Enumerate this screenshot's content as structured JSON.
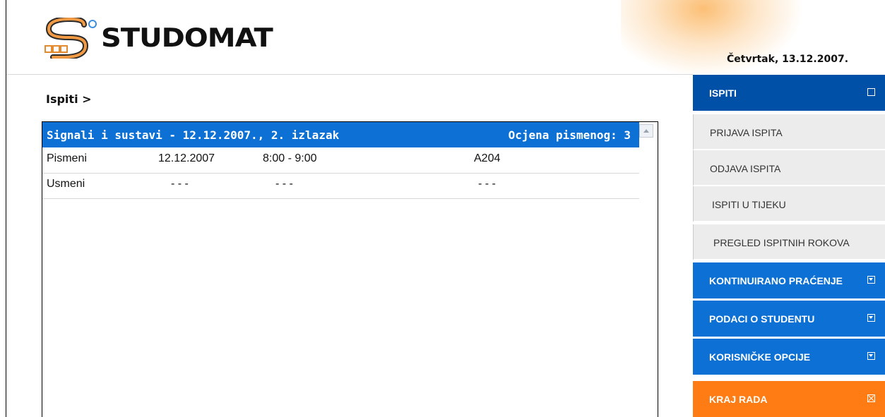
{
  "header": {
    "logo_text": "STUDOMAT",
    "date": "Četvrtak, 13.12.2007."
  },
  "breadcrumb": "Ispiti >",
  "exam": {
    "title": "Signali i sustavi - 12.12.2007., 2. izlazak",
    "grade": "Ocjena pismenog: 3",
    "rows": [
      {
        "type": "Pismeni",
        "date": "12.12.2007",
        "time": "8:00 - 9:00",
        "room": "A204"
      },
      {
        "type": "Usmeni",
        "date": "- - -",
        "time": "- - -",
        "room": "- - -"
      }
    ]
  },
  "sidebar": {
    "main": {
      "label": "ISPITI",
      "icon": "square-icon"
    },
    "submenu": [
      {
        "label": "PRIJAVA ISPITA"
      },
      {
        "label": "ODJAVA ISPITA"
      },
      {
        "label": "ISPITI U TIJEKU"
      },
      {
        "label": "PREGLED ISPITNIH ROKOVA"
      }
    ],
    "sections": [
      {
        "label": "KONTINUIRANO PRAĆENJE",
        "icon": "dropdown-icon"
      },
      {
        "label": "PODACI O STUDENTU",
        "icon": "dropdown-icon"
      },
      {
        "label": "KORISNIČKE OPCIJE",
        "icon": "dropdown-icon"
      }
    ],
    "logout": {
      "label": "KRAJ RADA",
      "icon": "close-box-icon"
    }
  },
  "colors": {
    "primary_blue": "#0c70d4",
    "dark_blue": "#0050a8",
    "orange": "#ff7c14",
    "submenu_gray": "#ececec"
  }
}
